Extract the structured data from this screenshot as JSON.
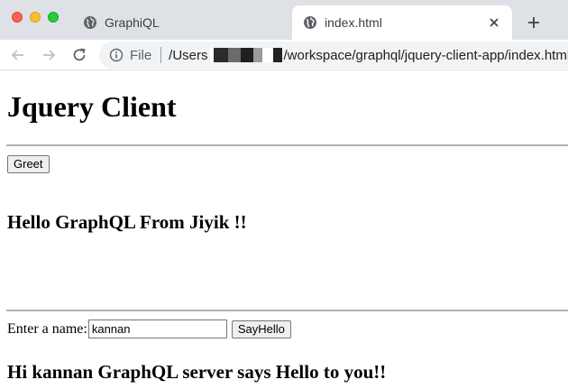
{
  "browser": {
    "tabs": [
      {
        "title": "GraphiQL",
        "active": false
      },
      {
        "title": "index.html",
        "active": true
      }
    ],
    "address": {
      "scheme_label": "File",
      "path_prefix": "/Users",
      "path_suffix": "/workspace/graphql/jquery-client-app/index.html"
    },
    "icons": {
      "back": "arrow-left-icon",
      "forward": "arrow-right-icon",
      "reload": "reload-icon",
      "info": "info-icon",
      "globe": "globe-icon",
      "close": "close-icon",
      "new_tab": "plus-icon"
    }
  },
  "page": {
    "heading": "Jquery Client",
    "greet_button": "Greet",
    "greeting_message": "Hello GraphQL From Jiyik !!",
    "name_label": "Enter a name:",
    "name_value": "kannan",
    "sayhello_button": "SayHello",
    "response_message": "Hi kannan GraphQL server says Hello to you!!"
  }
}
